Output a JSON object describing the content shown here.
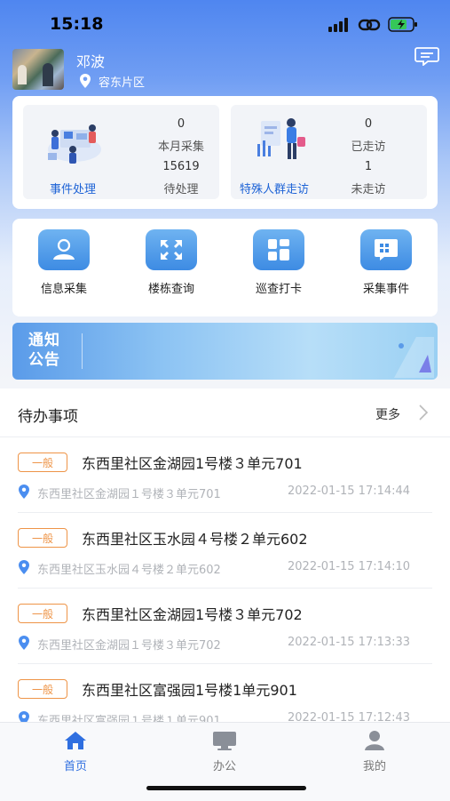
{
  "status_bar": {
    "time": "15:18"
  },
  "user": {
    "name": "邓波",
    "district": "容东片区"
  },
  "stats": [
    {
      "label": "事件处理",
      "top_value": "0",
      "top_label": "本月采集",
      "bottom_value": "15619",
      "bottom_label": "待处理"
    },
    {
      "label": "特殊人群走访",
      "top_value": "0",
      "top_label": "已走访",
      "bottom_value": "1",
      "bottom_label": "未走访"
    }
  ],
  "menu": [
    {
      "label": "信息采集",
      "icon": "person-icon"
    },
    {
      "label": "楼栋查询",
      "icon": "expand-icon"
    },
    {
      "label": "巡查打卡",
      "icon": "grid-icon"
    },
    {
      "label": "采集事件",
      "icon": "chat-grid-icon"
    }
  ],
  "banner": {
    "line1": "通知",
    "line2": "公告"
  },
  "todo": {
    "title": "待办事项",
    "more": "更多",
    "items": [
      {
        "badge": "一般",
        "title": "东西里社区金湖园1号楼３单元701",
        "address": "东西里社区金湖园１号楼３单元701",
        "time": "2022-01-15 17:14:44"
      },
      {
        "badge": "一般",
        "title": "东西里社区玉水园４号楼２单元602",
        "address": "东西里社区玉水园４号楼２单元602",
        "time": "2022-01-15 17:14:10"
      },
      {
        "badge": "一般",
        "title": "东西里社区金湖园1号楼３单元702",
        "address": "东西里社区金湖园１号楼３单元702",
        "time": "2022-01-15 17:13:33"
      },
      {
        "badge": "一般",
        "title": "东西里社区富强园1号楼1单元901",
        "address": "东西里社区富强园１号楼１单元901",
        "time": "2022-01-15 17:12:43"
      }
    ]
  },
  "tabs": [
    {
      "label": "首页",
      "icon": "home-icon",
      "active": true
    },
    {
      "label": "办公",
      "icon": "monitor-icon",
      "active": false
    },
    {
      "label": "我的",
      "icon": "user-icon",
      "active": false
    }
  ],
  "colors": {
    "accent": "#1e63d6",
    "badge": "#ee9447",
    "muted": "#b0b3b8"
  }
}
